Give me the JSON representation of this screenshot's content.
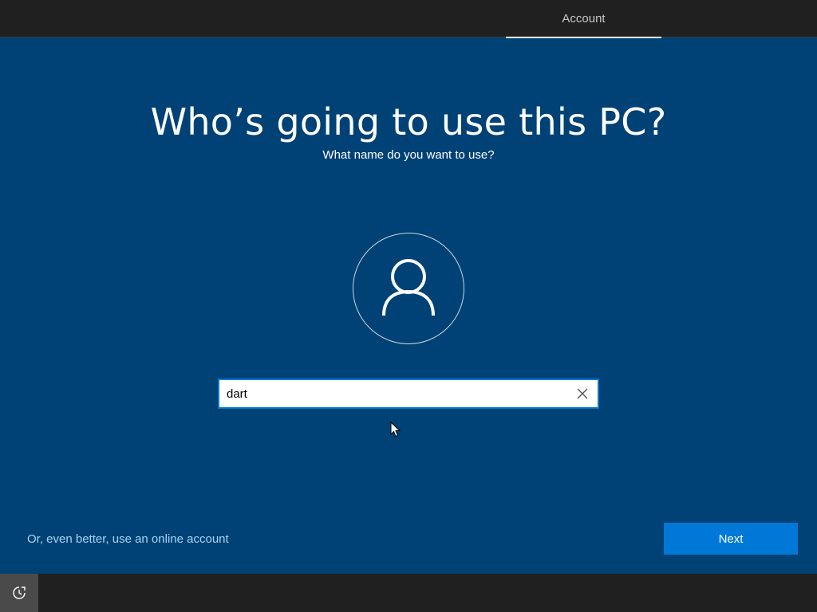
{
  "header": {
    "tabs": [
      {
        "label": "Account",
        "active": true
      }
    ]
  },
  "main": {
    "title": "Who’s going to use this PC?",
    "subtitle": "What name do you want to use?",
    "avatar_icon": "user-icon",
    "name_input": {
      "value": "dart",
      "placeholder": ""
    },
    "clear_icon": "close-icon",
    "online_account_link": "Or, even better, use an online account",
    "next_label": "Next"
  },
  "footer": {
    "ease_of_access_icon": "ease-of-access-icon"
  },
  "colors": {
    "background": "#004275",
    "topbar": "#202020",
    "accent": "#0078d7",
    "link": "#a9d3f5"
  }
}
